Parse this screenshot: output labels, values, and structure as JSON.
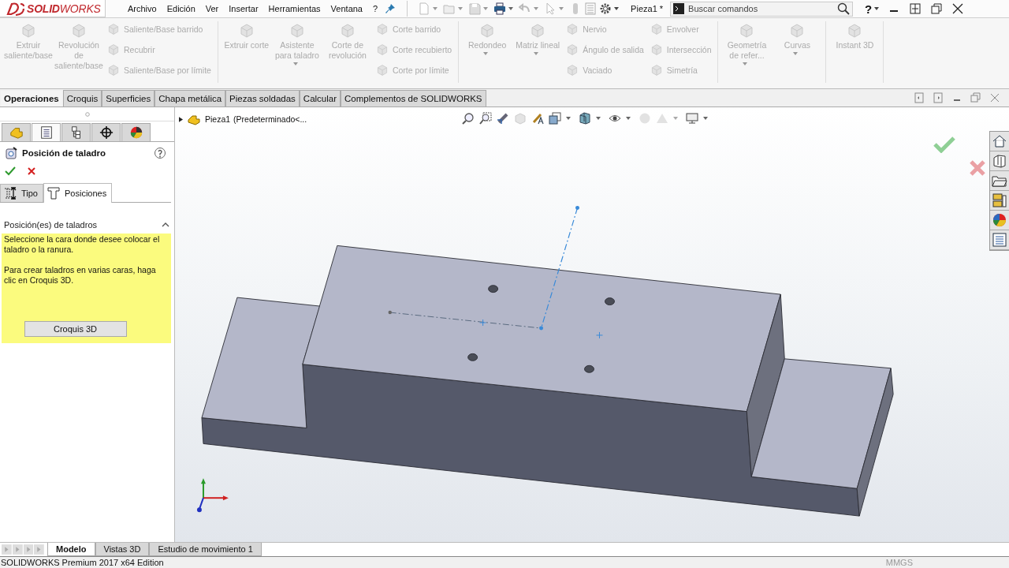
{
  "app": {
    "logo": "**SOLID**WORKS"
  },
  "menu": [
    {
      "label": "Archivo"
    },
    {
      "label": "Edición"
    },
    {
      "label": "Ver"
    },
    {
      "label": "Insertar"
    },
    {
      "label": "Herramientas"
    },
    {
      "label": "Ventana"
    },
    {
      "label": "?"
    }
  ],
  "document_title": "Pieza1 *",
  "search": {
    "placeholder": "Buscar comandos"
  },
  "help_button": "?",
  "ribbon": {
    "groups": [
      {
        "columns": [
          {
            "kind": "large",
            "label": "Extruir saliente/base",
            "dropdown": false,
            "disabled": true
          },
          {
            "kind": "large",
            "label": "Revolución de saliente/base",
            "dropdown": false,
            "disabled": true
          },
          {
            "kind": "stack",
            "commands": [
              {
                "label": "Saliente/Base barrido",
                "disabled": true
              },
              {
                "label": "Recubrir",
                "disabled": true
              },
              {
                "label": "Saliente/Base por límite",
                "disabled": true
              }
            ]
          }
        ]
      },
      {
        "columns": [
          {
            "kind": "large",
            "label": "Extruir corte",
            "dropdown": false,
            "disabled": true
          },
          {
            "kind": "large",
            "label": "Asistente para taladro",
            "dropdown": true,
            "disabled": true
          },
          {
            "kind": "large",
            "label": "Corte de revolución",
            "dropdown": false,
            "disabled": true
          },
          {
            "kind": "stack",
            "commands": [
              {
                "label": "Corte barrido",
                "disabled": true
              },
              {
                "label": "Corte recubierto",
                "disabled": true
              },
              {
                "label": "Corte por límite",
                "disabled": true
              }
            ]
          }
        ]
      },
      {
        "columns": [
          {
            "kind": "large",
            "label": "Redondeo",
            "dropdown": true,
            "disabled": true
          },
          {
            "kind": "large",
            "label": "Matriz lineal",
            "dropdown": true,
            "disabled": true
          },
          {
            "kind": "stack",
            "commands": [
              {
                "label": "Nervio",
                "disabled": true
              },
              {
                "label": "Ángulo de salida",
                "disabled": true
              },
              {
                "label": "Vaciado",
                "disabled": true
              }
            ]
          },
          {
            "kind": "stack",
            "commands": [
              {
                "label": "Envolver",
                "disabled": true
              },
              {
                "label": "Intersección",
                "disabled": true
              },
              {
                "label": "Simetría",
                "disabled": true
              }
            ]
          }
        ]
      },
      {
        "columns": [
          {
            "kind": "large",
            "label": "Geometría de refer...",
            "dropdown": true,
            "disabled": true
          },
          {
            "kind": "large",
            "label": "Curvas",
            "dropdown": true,
            "disabled": true
          }
        ]
      },
      {
        "columns": [
          {
            "kind": "large",
            "label": "Instant 3D",
            "dropdown": false,
            "disabled": true
          }
        ]
      }
    ]
  },
  "command_tabs": [
    {
      "label": "Operaciones",
      "selected": true
    },
    {
      "label": "Croquis",
      "selected": false
    },
    {
      "label": "Superficies",
      "selected": false
    },
    {
      "label": "Chapa metálica",
      "selected": false
    },
    {
      "label": "Piezas soldadas",
      "selected": false
    },
    {
      "label": "Calcular",
      "selected": false
    },
    {
      "label": "Complementos de SOLIDWORKS",
      "selected": false
    }
  ],
  "panel_tabs": [
    {
      "kind": "feature_tree",
      "selected": false
    },
    {
      "kind": "property_manager",
      "selected": true
    },
    {
      "kind": "configuration",
      "selected": false
    },
    {
      "kind": "dimxpert",
      "selected": false
    },
    {
      "kind": "display",
      "selected": false
    }
  ],
  "property_manager": {
    "title": "Posición de taladro",
    "subtabs": [
      {
        "label": "Tipo",
        "kind": "type",
        "selected": false
      },
      {
        "label": "Posiciones",
        "kind": "positions",
        "selected": true
      }
    ],
    "section": {
      "title": "Posición(es) de taladros",
      "expanded": true,
      "message": [
        "Seleccione la cara donde desee colocar el taladro o la ranura.",
        "Para crear taladros en varias caras, haga clic en Croquis 3D."
      ],
      "button": "Croquis 3D"
    }
  },
  "tree_flyout": {
    "part": "Pieza1",
    "configuration": "(Predeterminado<...",
    "expanded": false
  },
  "bottom_tabs": [
    {
      "label": "Modelo",
      "selected": true
    },
    {
      "label": "Vistas 3D",
      "selected": false
    },
    {
      "label": "Estudio de movimiento 1",
      "selected": false
    }
  ],
  "status_bar": {
    "edition": "SOLIDWORKS Premium 2017 x64 Edition",
    "units": "MMGS"
  }
}
